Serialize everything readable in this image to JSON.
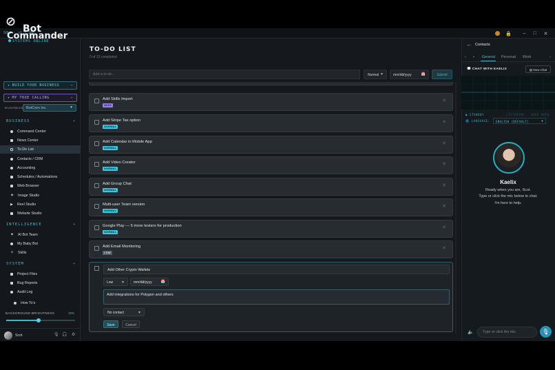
{
  "titlebar": {
    "build": "SOLO · v1.1.208"
  },
  "brand": {
    "line1": "Bot",
    "line2": "Commander",
    "status": "SYSTEMS ONLINE"
  },
  "cta": {
    "build_business": "BUILD YOUR BUSINESS",
    "true_calling": "MY TRUE CALLING"
  },
  "business": {
    "label": "BUSINESS:",
    "selected": "BotCom Inc"
  },
  "sections": {
    "business": "BUSINESS",
    "intelligence": "INTELLIGENCE",
    "system": "SYSTEM"
  },
  "nav_business": [
    "Command Center",
    "News Center",
    "To-Do List",
    "Contacts / CRM",
    "Accounting",
    "Schedules / Automations",
    "Web Browser",
    "Image Studio",
    "Reel Studio",
    "Website Studio"
  ],
  "nav_intelligence": [
    "AI Bot Team",
    "My Baby Bot",
    "Skills"
  ],
  "nav_system": [
    "Project Files",
    "Bug Reports",
    "Audit Log",
    "How To's"
  ],
  "brightness": {
    "label": "BACKGROUND BRIGHTNESS",
    "value": "10%",
    "fraction": 0.47
  },
  "user": {
    "name": "Scot"
  },
  "page": {
    "title": "TO-DO LIST",
    "subtitle": "0 of 13 completed"
  },
  "add": {
    "placeholder": "Add a to-do...",
    "priority": "Normal",
    "date": "mm/dd/yyyy",
    "submit": "Submit"
  },
  "todos": [
    {
      "title": "Add Skills Import",
      "tag": "HIGH"
    },
    {
      "title": "Add Stripe Tax option",
      "tag": "NORMAL"
    },
    {
      "title": "Add Calendar in Mobile App",
      "tag": "NORMAL"
    },
    {
      "title": "Add Video Creator",
      "tag": "NORMAL"
    },
    {
      "title": "Add Group Chat",
      "tag": "NORMAL"
    },
    {
      "title": "Multi-user Team version",
      "tag": "NORMAL"
    },
    {
      "title": "Google Play — 5 more testers for production",
      "tag": "NORMAL"
    },
    {
      "title": "Add Email Monitoring",
      "tag": "LOW"
    }
  ],
  "editing": {
    "title": "Add Other Crypto Wallets",
    "priority": "Low",
    "date": "mm/dd/yyyy",
    "description": "Add integrations for Polygon and others",
    "contact": "No contact",
    "save": "Save",
    "cancel": "Cancel"
  },
  "contacts": {
    "title": "Contacts",
    "tabs": [
      "General",
      "Personal",
      "Work"
    ],
    "chat_with": "CHAT WITH KAELIX",
    "new_chat": "New Chat",
    "status": "STANDBY",
    "status_hint": "· LISTENING · WAKE WORD",
    "language_label": "LANGUAGE:",
    "language": "ENGLISH (DEFAULT)",
    "agent_name": "Kaelix",
    "messages": [
      "Ready when you are, Scot.",
      "Type or click the mic below to chat.",
      "I'm here to help."
    ],
    "input_placeholder": "Type or click the mic"
  }
}
